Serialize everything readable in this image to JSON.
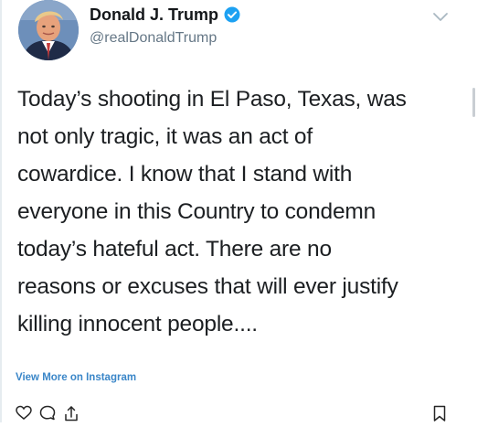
{
  "header": {
    "display_name": "Donald J. Trump",
    "handle": "@realDonaldTrump",
    "verified": true
  },
  "tweet": {
    "lines": [
      "Today’s shooting in El Paso, Texas, was",
      "not only tragic, it was an act of",
      "cowardice. I know that I stand with",
      "everyone in this Country to condemn",
      "today’s hateful act. There are no",
      "reasons or excuses that will ever justify",
      "killing innocent people...."
    ]
  },
  "footer": {
    "view_more_label": "View More on Instagram"
  },
  "icons": {
    "verified": "verified-badge-icon",
    "menu": "chevron-down-icon",
    "like": "heart-icon",
    "comment": "comment-icon",
    "share": "share-icon",
    "bookmark": "bookmark-icon"
  },
  "colors": {
    "verified_blue": "#1da1f2",
    "link_blue": "#3a86c8",
    "secondary_text": "#657786"
  }
}
